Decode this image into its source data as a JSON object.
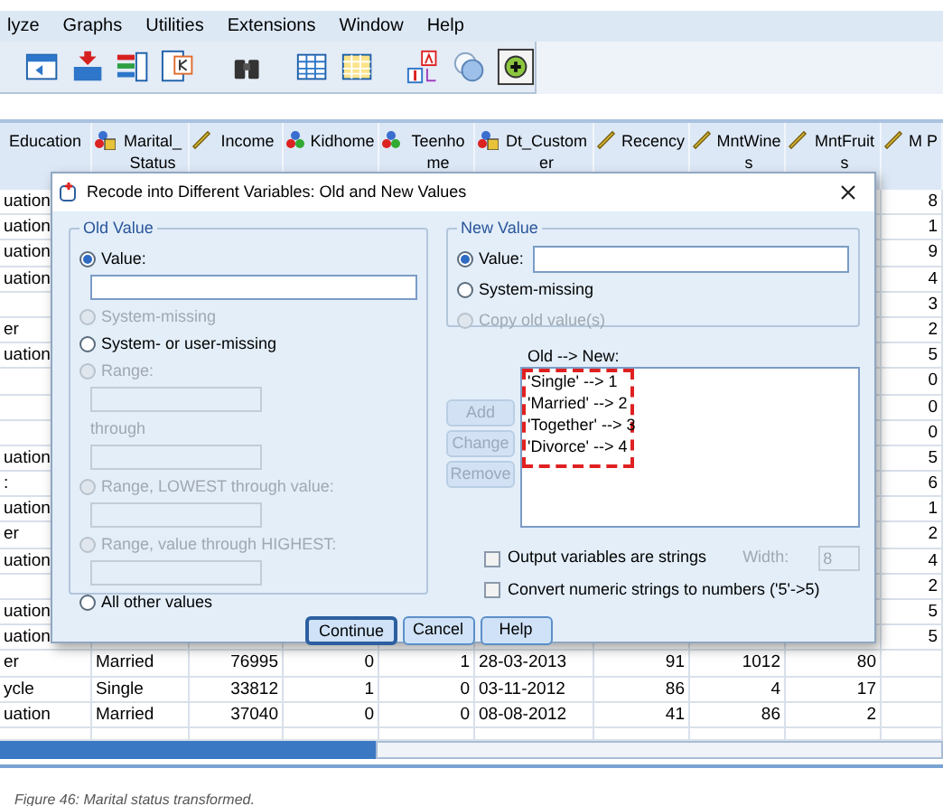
{
  "menu": [
    "lyze",
    "Graphs",
    "Utilities",
    "Extensions",
    "Window",
    "Help"
  ],
  "table": {
    "columns": [
      {
        "label": "Education",
        "kind": "none"
      },
      {
        "label": "Marital_Status",
        "kind": "nominal_string"
      },
      {
        "label": "Income",
        "kind": "scale"
      },
      {
        "label": "Kidhome",
        "kind": "nominal"
      },
      {
        "label": "Teenhome",
        "kind": "nominal"
      },
      {
        "label": "Dt_Customer",
        "kind": "nominal_string"
      },
      {
        "label": "Recency",
        "kind": "scale"
      },
      {
        "label": "MntWines",
        "kind": "scale"
      },
      {
        "label": "MntFruits",
        "kind": "scale"
      },
      {
        "label": "M P",
        "kind": "scale"
      }
    ],
    "rows": [
      {
        "cells": [
          "uation",
          null,
          null,
          null,
          null,
          null,
          null,
          null,
          null,
          "8"
        ]
      },
      {
        "cells": [
          "uation",
          null,
          null,
          null,
          null,
          null,
          null,
          null,
          null,
          "1"
        ]
      },
      {
        "cells": [
          "uation",
          null,
          null,
          null,
          null,
          null,
          null,
          null,
          null,
          "9"
        ]
      },
      {
        "cells": [
          "uation",
          null,
          null,
          null,
          null,
          null,
          null,
          null,
          null,
          "4"
        ]
      },
      {
        "cells": [
          null,
          null,
          null,
          null,
          null,
          null,
          null,
          null,
          null,
          "3"
        ]
      },
      {
        "cells": [
          "er",
          null,
          null,
          null,
          null,
          null,
          null,
          null,
          null,
          "2"
        ]
      },
      {
        "cells": [
          "uation",
          null,
          null,
          null,
          null,
          null,
          null,
          null,
          null,
          "5"
        ]
      },
      {
        "cells": [
          null,
          null,
          null,
          null,
          null,
          null,
          null,
          null,
          null,
          "0"
        ]
      },
      {
        "cells": [
          null,
          null,
          null,
          null,
          null,
          null,
          null,
          null,
          null,
          "0"
        ]
      },
      {
        "cells": [
          null,
          null,
          null,
          null,
          null,
          null,
          null,
          null,
          null,
          "0"
        ]
      },
      {
        "cells": [
          "uation",
          null,
          null,
          null,
          null,
          null,
          null,
          null,
          null,
          "5"
        ]
      },
      {
        "cells": [
          ":",
          null,
          null,
          null,
          null,
          null,
          null,
          null,
          null,
          "6"
        ]
      },
      {
        "cells": [
          "uation",
          null,
          null,
          null,
          null,
          null,
          null,
          null,
          null,
          "1"
        ]
      },
      {
        "cells": [
          "er",
          null,
          null,
          null,
          null,
          null,
          null,
          null,
          null,
          "2"
        ]
      },
      {
        "cells": [
          "uation",
          null,
          null,
          null,
          null,
          null,
          null,
          null,
          null,
          "4"
        ]
      },
      {
        "cells": [
          null,
          null,
          null,
          null,
          null,
          null,
          null,
          null,
          null,
          "2"
        ]
      },
      {
        "cells": [
          "uation",
          null,
          null,
          null,
          null,
          null,
          null,
          null,
          null,
          "5"
        ]
      },
      {
        "cells": [
          "uation",
          null,
          null,
          null,
          null,
          null,
          null,
          null,
          null,
          "5"
        ]
      },
      {
        "cells": [
          "er",
          "Married",
          "76995",
          "0",
          "1",
          "28-03-2013",
          "91",
          "1012",
          "80",
          null
        ]
      },
      {
        "cells": [
          "ycle",
          "Single",
          "33812",
          "1",
          "0",
          "03-11-2012",
          "86",
          "4",
          "17",
          null
        ]
      },
      {
        "cells": [
          "uation",
          "Married",
          "37040",
          "0",
          "0",
          "08-08-2012",
          "41",
          "86",
          "2",
          null
        ]
      },
      {
        "cells": [
          null,
          null,
          null,
          null,
          null,
          null,
          null,
          null,
          null,
          null
        ]
      }
    ]
  },
  "dialog": {
    "title": "Recode into Different Variables: Old and New Values",
    "old_value": {
      "legend": "Old Value",
      "items": [
        {
          "kind": "radio",
          "label": "Value:",
          "selected": true,
          "disabled": false
        },
        {
          "kind": "field",
          "disabled": false
        },
        {
          "kind": "radio",
          "label": "System-missing",
          "selected": false,
          "disabled": true
        },
        {
          "kind": "radio",
          "label": "System- or user-missing",
          "selected": false,
          "disabled": false
        },
        {
          "kind": "radio",
          "label": "Range:",
          "selected": false,
          "disabled": true
        },
        {
          "kind": "short_field",
          "disabled": true
        },
        {
          "kind": "label",
          "label": "through",
          "disabled": true
        },
        {
          "kind": "short_field",
          "disabled": true
        },
        {
          "kind": "radio",
          "label": "Range, LOWEST through value:",
          "selected": false,
          "disabled": true
        },
        {
          "kind": "short_field",
          "disabled": true
        },
        {
          "kind": "radio",
          "label": "Range, value through HIGHEST:",
          "selected": false,
          "disabled": true
        },
        {
          "kind": "short_field",
          "disabled": true
        },
        {
          "kind": "radio",
          "label": "All other values",
          "selected": false,
          "disabled": false
        }
      ]
    },
    "new_value": {
      "legend": "New Value",
      "items": [
        {
          "kind": "radio_field",
          "label": "Value:",
          "selected": true,
          "disabled": false
        },
        {
          "kind": "radio",
          "label": "System-missing",
          "selected": false,
          "disabled": false
        },
        {
          "kind": "radio",
          "label": "Copy old value(s)",
          "selected": false,
          "disabled": true
        }
      ]
    },
    "action_buttons": [
      {
        "label": "Add",
        "disabled": true
      },
      {
        "label": "Change",
        "disabled": true
      },
      {
        "label": "Remove",
        "disabled": true
      }
    ],
    "mapping": {
      "label": "Old --> New:",
      "annotated": true,
      "entries": [
        "'Single' --> 1",
        "'Married' --> 2",
        "'Together' --> 3",
        "'Divorce' --> 4"
      ]
    },
    "options": [
      {
        "label": "Output variables are strings",
        "checked": false
      },
      {
        "label": "Convert numeric strings to numbers ('5'->5)",
        "checked": false
      }
    ],
    "width": {
      "label": "Width:",
      "value": "8",
      "disabled": true
    },
    "buttons": [
      {
        "label": "Continue",
        "default": true
      },
      {
        "label": "Cancel",
        "default": false
      },
      {
        "label": "Help",
        "default": false
      }
    ]
  },
  "caption": "Figure 46: Marital status transformed."
}
